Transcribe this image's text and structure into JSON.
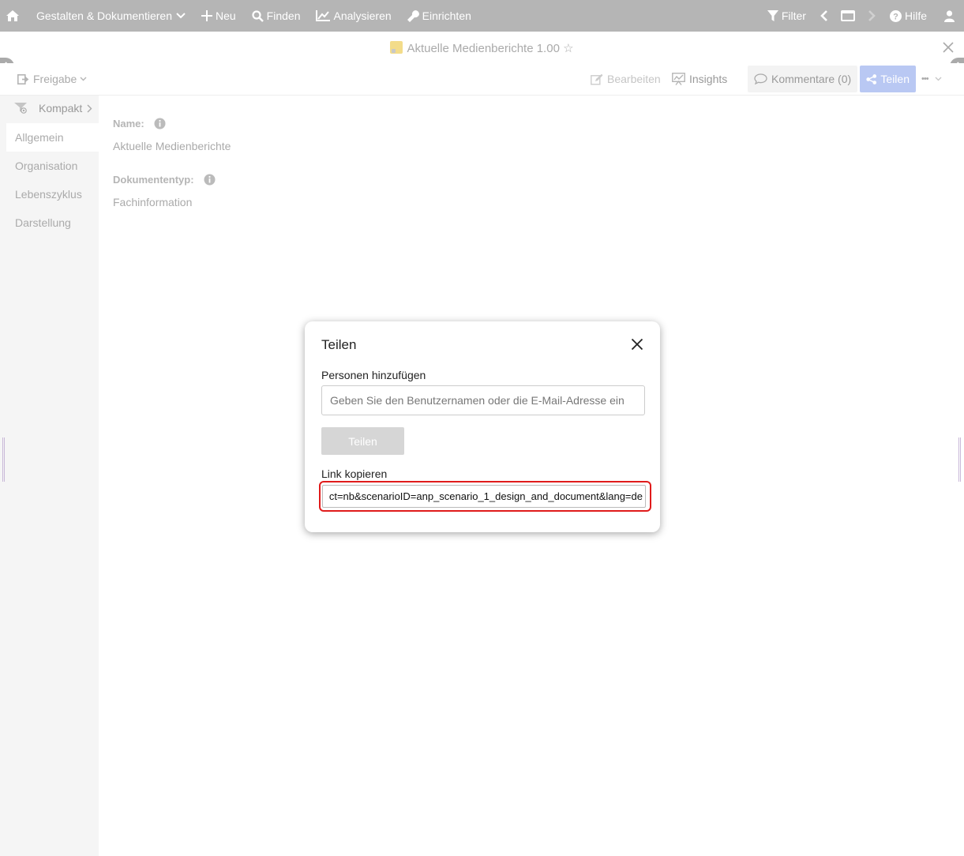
{
  "topbar": {
    "home_icon": "home-icon",
    "menu": [
      {
        "label": "Gestalten & Dokumentieren",
        "icon": "chevron-down-icon"
      },
      {
        "label": "Neu",
        "icon": "plus-icon"
      },
      {
        "label": "Finden",
        "icon": "search-icon"
      },
      {
        "label": "Analysieren",
        "icon": "chart-icon"
      },
      {
        "label": "Einrichten",
        "icon": "wrench-icon"
      }
    ],
    "filter_label": "Filter",
    "hilfe_label": "Hilfe"
  },
  "document": {
    "title": "Aktuelle Medienberichte 1.00 ☆"
  },
  "toolbar": {
    "freigabe_label": "Freigabe",
    "bearbeiten_label": "Bearbeiten",
    "insights_label": "Insights",
    "kommentare_label": "Kommentare (0)",
    "teilen_label": "Teilen",
    "more_label": "•••"
  },
  "sidebar": {
    "view_label": "Kompakt",
    "items": [
      {
        "label": "Allgemein",
        "active": true
      },
      {
        "label": "Organisation",
        "active": false
      },
      {
        "label": "Lebenszyklus",
        "active": false
      },
      {
        "label": "Darstellung",
        "active": false
      }
    ]
  },
  "main": {
    "fields": [
      {
        "label": "Name:",
        "value": "Aktuelle Medienberichte"
      },
      {
        "label": "Dokumententyp:",
        "value": "Fachinformation"
      }
    ]
  },
  "modal": {
    "title": "Teilen",
    "add_people_label": "Personen hinzufügen",
    "add_people_placeholder": "Geben Sie den Benutzernamen oder die E-Mail-Adresse ein",
    "share_button": "Teilen",
    "copy_link_label": "Link kopieren",
    "link_value": "ct=nb&scenarioID=anp_scenario_1_design_and_document&lang=de"
  },
  "colors": {
    "topbar_bg": "#b5b5b5",
    "teilen_button_bg": "#b9c8f3",
    "highlight_outline": "#e01b1b"
  }
}
